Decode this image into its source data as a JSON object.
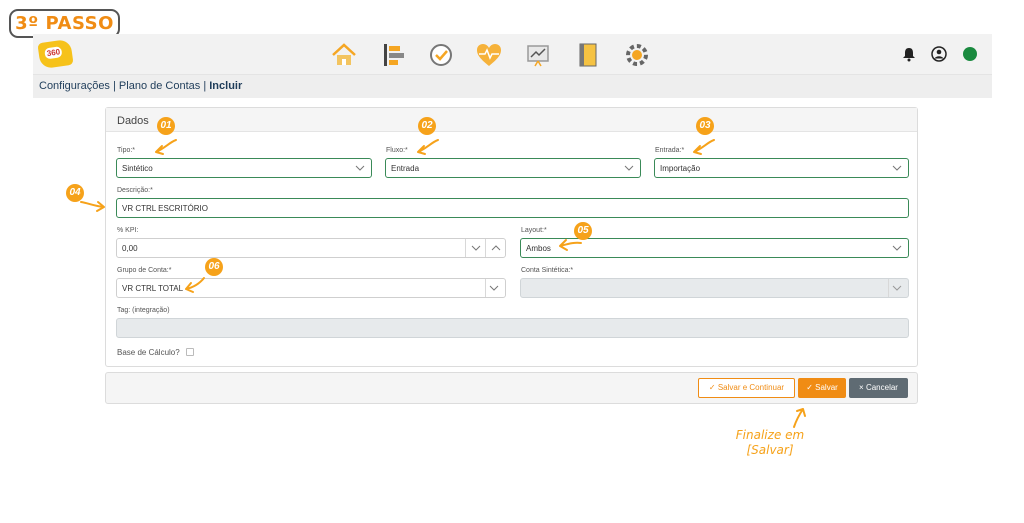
{
  "step_badge": "3º PASSO",
  "topbar": {
    "logo_text": "360",
    "nav_icons": [
      "home-icon",
      "list-icon",
      "check-circle-icon",
      "heart-pulse-icon",
      "chart-icon",
      "notebook-icon",
      "gear-icon"
    ],
    "right_icons": [
      "bell-icon",
      "user-icon",
      "status-dot-icon"
    ],
    "status_color": "#1a8a3f"
  },
  "breadcrumb": {
    "part1": "Configurações",
    "sep1": " | ",
    "part2": "Plano de Contas",
    "sep2": " | ",
    "current": "Incluir"
  },
  "panel": {
    "title": "Dados",
    "tipo": {
      "label": "Tipo:*",
      "value": "Sintético"
    },
    "fluxo": {
      "label": "Fluxo:*",
      "value": "Entrada"
    },
    "entrada": {
      "label": "Entrada:*",
      "value": "Importação"
    },
    "descricao": {
      "label": "Descrição:*",
      "value": "VR CTRL ESCRITÓRIO"
    },
    "kpi": {
      "label": "% KPI:",
      "value": "0,00"
    },
    "layout": {
      "label": "Layout:*",
      "value": "Ambos"
    },
    "grupo": {
      "label": "Grupo de Conta:*",
      "value": "VR CTRL TOTAL"
    },
    "conta_sintetica": {
      "label": "Conta Sintética:*",
      "value": ""
    },
    "tag": {
      "label": "Tag: (integração)",
      "value": ""
    },
    "base_calculo": {
      "label": "Base de Cálculo?"
    }
  },
  "footer": {
    "save_continue": "Salvar e Continuar",
    "save": "Salvar",
    "cancel": "Cancelar"
  },
  "annotations": {
    "steps": [
      "01",
      "02",
      "03",
      "04",
      "05",
      "06"
    ],
    "finalize_line1": "Finalize em",
    "finalize_line2": "[Salvar]",
    "accent": "#f6a21a"
  }
}
